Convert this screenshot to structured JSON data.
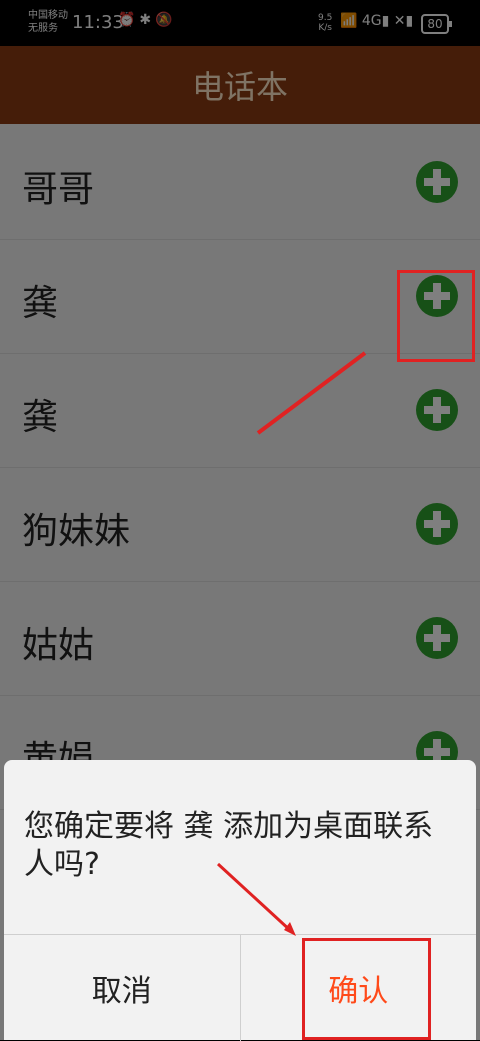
{
  "status_bar": {
    "carrier_line1": "中国移动",
    "carrier_line2": "无服务",
    "time": "11:33",
    "left_icons": "⏰✱🔕",
    "net_speed_top": "9.5",
    "net_speed_bottom": "K/s",
    "right_icons": "📶 4G▮ ✕▮",
    "battery": "80"
  },
  "header": {
    "title": "电话本"
  },
  "contacts": [
    {
      "name": "哥哥"
    },
    {
      "name": "龚"
    },
    {
      "name": "龚"
    },
    {
      "name": "狗妹妹"
    },
    {
      "name": "姑姑"
    },
    {
      "name": "黄娟"
    }
  ],
  "dialog": {
    "message": "您确定要将 龚 添加为桌面联系人吗?",
    "cancel_label": "取消",
    "confirm_label": "确认"
  },
  "colors": {
    "header_bg": "#8a3a12",
    "add_button": "#2fa12e",
    "confirm_text": "#ff4a1a",
    "annotation": "#e02222"
  },
  "icons": {
    "add": "plus-circle-icon"
  }
}
